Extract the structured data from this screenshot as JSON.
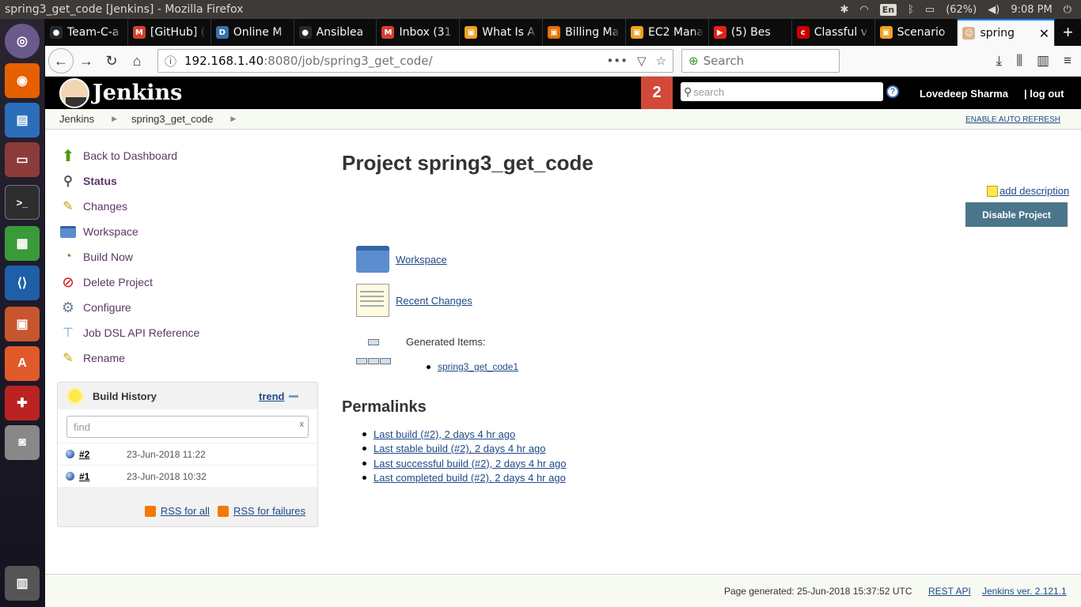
{
  "os": {
    "window_title": "spring3_get_code [Jenkins] - Mozilla Firefox",
    "lang_indicator": "En",
    "battery": "(62%)",
    "clock": "9:08 PM"
  },
  "browser": {
    "tabs": [
      {
        "label": "Team-C-a",
        "icon": "github-icon",
        "color": "#24292e",
        "glyph": "●"
      },
      {
        "label": "[GitHub] (",
        "icon": "gmail-icon",
        "color": "#d23f31",
        "glyph": "M"
      },
      {
        "label": "Online M",
        "icon": "doc-icon",
        "color": "#3a6fb0",
        "glyph": "D"
      },
      {
        "label": "Ansiblea",
        "icon": "github-icon",
        "color": "#24292e",
        "glyph": "●"
      },
      {
        "label": "Inbox (31",
        "icon": "gmail-icon",
        "color": "#d23f31",
        "glyph": "M"
      },
      {
        "label": "What Is A",
        "icon": "aws-icon",
        "color": "#f0a11f",
        "glyph": "▣"
      },
      {
        "label": "Billing Ma",
        "icon": "aws-icon",
        "color": "#e76f00",
        "glyph": "▣"
      },
      {
        "label": "EC2 Mana",
        "icon": "aws-icon",
        "color": "#f0a11f",
        "glyph": "▣"
      },
      {
        "label": "(5) Bes",
        "icon": "youtube-icon",
        "color": "#e62117",
        "glyph": "▶"
      },
      {
        "label": "Classful v",
        "icon": "cisco-icon",
        "color": "#c00",
        "glyph": "c"
      },
      {
        "label": "Scenario",
        "icon": "aws-icon",
        "color": "#f0a11f",
        "glyph": "▣"
      }
    ],
    "active_tab": {
      "label": "spring",
      "icon": "jenkins-icon"
    },
    "url_host": "192.168.1.40",
    "url_path": ":8080/job/spring3_get_code/",
    "search_placeholder": "Search"
  },
  "jenkins": {
    "logo_text": "Jenkins",
    "notification_count": "2",
    "search_placeholder": "search",
    "user_name": "Lovedeep Sharma",
    "logout_label": "| log out",
    "breadcrumbs": [
      "Jenkins",
      "spring3_get_code"
    ],
    "auto_refresh_label": "ENABLE AUTO REFRESH",
    "tasks": [
      {
        "label": "Back to Dashboard",
        "icon": "up-arrow-icon"
      },
      {
        "label": "Status",
        "icon": "magnifier-icon"
      },
      {
        "label": "Changes",
        "icon": "notepad-icon"
      },
      {
        "label": "Workspace",
        "icon": "folder-icon"
      },
      {
        "label": "Build Now",
        "icon": "clock-icon"
      },
      {
        "label": "Delete Project",
        "icon": "no-entry-icon"
      },
      {
        "label": "Configure",
        "icon": "gear-icon"
      },
      {
        "label": "Job DSL API Reference",
        "icon": "tree-icon"
      },
      {
        "label": "Rename",
        "icon": "notepad-icon"
      }
    ],
    "build_history": {
      "title": "Build History",
      "trend_label": "trend",
      "find_placeholder": "find",
      "find_clear": "x",
      "builds": [
        {
          "number": "#2",
          "date": "23-Jun-2018 11:22"
        },
        {
          "number": "#1",
          "date": "23-Jun-2018 10:32"
        }
      ],
      "rss_all": "RSS for all",
      "rss_failures": "RSS for failures"
    },
    "main": {
      "title": "Project spring3_get_code",
      "add_description": "add description",
      "disable_button": "Disable Project",
      "workspace_link": "Workspace",
      "recent_changes_link": "Recent Changes",
      "generated_items_label": "Generated Items:",
      "generated_items": [
        "spring3_get_code1"
      ],
      "permalinks_title": "Permalinks",
      "permalinks": [
        "Last build (#2), 2 days 4 hr ago",
        "Last stable build (#2), 2 days 4 hr ago",
        "Last successful build (#2), 2 days 4 hr ago",
        "Last completed build (#2), 2 days 4 hr ago"
      ]
    },
    "footer": {
      "generated": "Page generated: 25-Jun-2018 15:37:52 UTC",
      "rest_api": "REST API",
      "version": "Jenkins ver. 2.121.1"
    }
  }
}
